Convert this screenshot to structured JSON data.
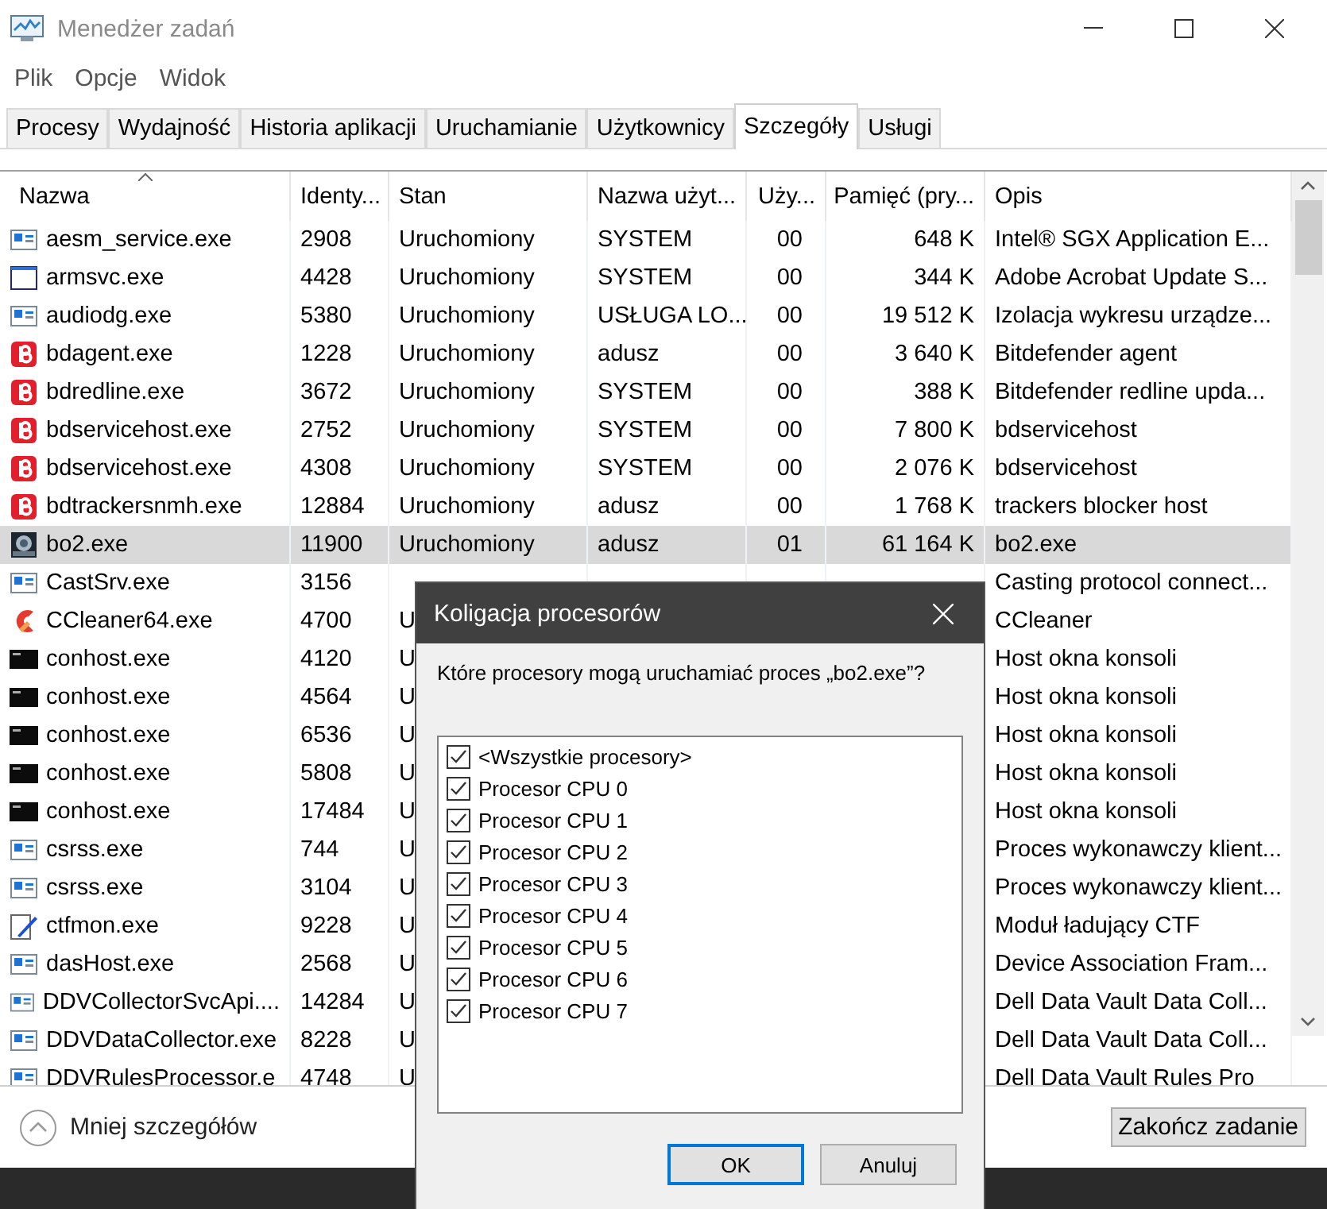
{
  "window": {
    "title": "Menedżer zadań"
  },
  "menu": [
    "Plik",
    "Opcje",
    "Widok"
  ],
  "tabs": [
    {
      "label": "Procesy",
      "selected": false
    },
    {
      "label": "Wydajność",
      "selected": false
    },
    {
      "label": "Historia aplikacji",
      "selected": false
    },
    {
      "label": "Uruchamianie",
      "selected": false
    },
    {
      "label": "Użytkownicy",
      "selected": false
    },
    {
      "label": "Szczegóły",
      "selected": true
    },
    {
      "label": "Usługi",
      "selected": false
    }
  ],
  "table": {
    "columns": [
      {
        "label": "Nazwa",
        "sorted": true
      },
      {
        "label": "Identy...",
        "sorted": false
      },
      {
        "label": "Stan",
        "sorted": false
      },
      {
        "label": "Nazwa użyt...",
        "sorted": false
      },
      {
        "label": "Uży...",
        "sorted": false
      },
      {
        "label": "Pamięć (pry...",
        "sorted": false
      },
      {
        "label": "Opis",
        "sorted": false
      }
    ],
    "rows": [
      {
        "kind": "window",
        "name": "aesm_service.exe",
        "pid": "2908",
        "status": "Uruchomiony",
        "user": "SYSTEM",
        "cpu": "00",
        "memory": "648 K",
        "description": "Intel® SGX Application E...",
        "selected": false
      },
      {
        "kind": "blank",
        "name": "armsvc.exe",
        "pid": "4428",
        "status": "Uruchomiony",
        "user": "SYSTEM",
        "cpu": "00",
        "memory": "344 K",
        "description": "Adobe Acrobat Update S...",
        "selected": false
      },
      {
        "kind": "window",
        "name": "audiodg.exe",
        "pid": "5380",
        "status": "Uruchomiony",
        "user": "USŁUGA LO...",
        "cpu": "00",
        "memory": "19 512 K",
        "description": "Izolacja wykresu urządze...",
        "selected": false
      },
      {
        "kind": "shield",
        "name": "bdagent.exe",
        "pid": "1228",
        "status": "Uruchomiony",
        "user": "adusz",
        "cpu": "00",
        "memory": "3 640 K",
        "description": "Bitdefender agent",
        "selected": false
      },
      {
        "kind": "shield",
        "name": "bdredline.exe",
        "pid": "3672",
        "status": "Uruchomiony",
        "user": "SYSTEM",
        "cpu": "00",
        "memory": "388 K",
        "description": "Bitdefender redline upda...",
        "selected": false
      },
      {
        "kind": "shield",
        "name": "bdservicehost.exe",
        "pid": "2752",
        "status": "Uruchomiony",
        "user": "SYSTEM",
        "cpu": "00",
        "memory": "7 800 K",
        "description": "bdservicehost",
        "selected": false
      },
      {
        "kind": "shield",
        "name": "bdservicehost.exe",
        "pid": "4308",
        "status": "Uruchomiony",
        "user": "SYSTEM",
        "cpu": "00",
        "memory": "2 076 K",
        "description": "bdservicehost",
        "selected": false
      },
      {
        "kind": "shield",
        "name": "bdtrackersnmh.exe",
        "pid": "12884",
        "status": "Uruchomiony",
        "user": "adusz",
        "cpu": "00",
        "memory": "1 768 K",
        "description": "trackers blocker host",
        "selected": false
      },
      {
        "kind": "game",
        "name": "bo2.exe",
        "pid": "11900",
        "status": "Uruchomiony",
        "user": "adusz",
        "cpu": "01",
        "memory": "61 164 K",
        "description": "bo2.exe",
        "selected": true
      },
      {
        "kind": "window",
        "name": "CastSrv.exe",
        "pid": "3156",
        "description": "Casting protocol connect...",
        "selected": false
      },
      {
        "kind": "brush",
        "name": "CCleaner64.exe",
        "pid": "4700",
        "status": "U",
        "description": "CCleaner",
        "selected": false
      },
      {
        "kind": "console",
        "name": "conhost.exe",
        "pid": "4120",
        "status": "U",
        "description": "Host okna konsoli",
        "selected": false
      },
      {
        "kind": "console",
        "name": "conhost.exe",
        "pid": "4564",
        "status": "U",
        "description": "Host okna konsoli",
        "selected": false
      },
      {
        "kind": "console",
        "name": "conhost.exe",
        "pid": "6536",
        "status": "U",
        "description": "Host okna konsoli",
        "selected": false
      },
      {
        "kind": "console",
        "name": "conhost.exe",
        "pid": "5808",
        "status": "U",
        "description": "Host okna konsoli",
        "selected": false
      },
      {
        "kind": "console",
        "name": "conhost.exe",
        "pid": "17484",
        "status": "U",
        "description": "Host okna konsoli",
        "selected": false
      },
      {
        "kind": "window",
        "name": "csrss.exe",
        "pid": "744",
        "status": "U",
        "description": "Proces wykonawczy klient...",
        "selected": false
      },
      {
        "kind": "window",
        "name": "csrss.exe",
        "pid": "3104",
        "status": "U",
        "description": "Proces wykonawczy klient...",
        "selected": false
      },
      {
        "kind": "pen",
        "name": "ctfmon.exe",
        "pid": "9228",
        "status": "U",
        "description": "Moduł ładujący CTF",
        "selected": false
      },
      {
        "kind": "window",
        "name": "dasHost.exe",
        "pid": "2568",
        "status": "U",
        "description": "Device Association Fram...",
        "selected": false
      },
      {
        "kind": "window",
        "name": "DDVCollectorSvcApi....",
        "pid": "14284",
        "status": "U",
        "description": "Dell Data Vault Data Coll...",
        "selected": false
      },
      {
        "kind": "window",
        "name": "DDVDataCollector.exe",
        "pid": "8228",
        "status": "U",
        "description": "Dell Data Vault Data Coll...",
        "selected": false
      },
      {
        "kind": "window",
        "name": "DDVRulesProcessor.e",
        "pid": "4748",
        "status": "U",
        "description": "Dell Data Vault Rules Pro",
        "selected": false
      }
    ]
  },
  "footer": {
    "toggle": "Mniej szczegółów",
    "end_task": "Zakończ zadanie"
  },
  "dialog": {
    "title": "Koligacja procesorów",
    "question": "Które procesory mogą uruchamiać proces „bo2.exe”?",
    "processors": [
      {
        "label": "<Wszystkie procesory>",
        "checked": true
      },
      {
        "label": "Procesor CPU 0",
        "checked": true
      },
      {
        "label": "Procesor CPU 1",
        "checked": true
      },
      {
        "label": "Procesor CPU 2",
        "checked": true
      },
      {
        "label": "Procesor CPU 3",
        "checked": true
      },
      {
        "label": "Procesor CPU 4",
        "checked": true
      },
      {
        "label": "Procesor CPU 5",
        "checked": true
      },
      {
        "label": "Procesor CPU 6",
        "checked": true
      },
      {
        "label": "Procesor CPU 7",
        "checked": true
      }
    ],
    "buttons": [
      {
        "label": "OK",
        "default": true
      },
      {
        "label": "Anuluj",
        "default": false
      }
    ]
  }
}
